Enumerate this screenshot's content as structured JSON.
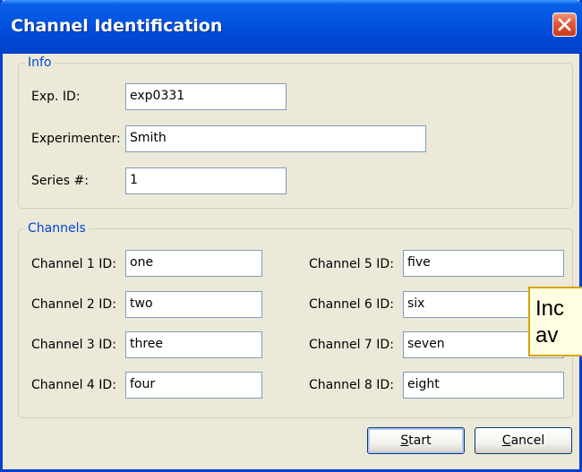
{
  "window": {
    "title": "Channel Identification"
  },
  "info": {
    "legend": "Info",
    "exp_id_label": "Exp. ID:",
    "exp_id_value": "exp0331",
    "experimenter_label": "Experimenter:",
    "experimenter_value": "Smith",
    "series_label": "Series #:",
    "series_value": "1"
  },
  "channels": {
    "legend": "Channels",
    "items": [
      {
        "label": "Channel 1 ID:",
        "value": "one"
      },
      {
        "label": "Channel 2 ID:",
        "value": "two"
      },
      {
        "label": "Channel 3 ID:",
        "value": "three"
      },
      {
        "label": "Channel 4 ID:",
        "value": "four"
      },
      {
        "label": "Channel 5 ID:",
        "value": "five"
      },
      {
        "label": "Channel 6 ID:",
        "value": "six"
      },
      {
        "label": "Channel 7 ID:",
        "value": "seven"
      },
      {
        "label": "Channel 8 ID:",
        "value": "eight"
      }
    ]
  },
  "buttons": {
    "start_mnemonic": "S",
    "start_rest": "tart",
    "cancel_mnemonic": "C",
    "cancel_rest": "ancel"
  },
  "tooltip": {
    "line1": "Inc",
    "line2": "av"
  },
  "icons": {
    "close": "close-icon"
  },
  "colors": {
    "title_bar": "#0047d4",
    "dialog_bg": "#ece9d8",
    "group_legend": "#0046d5",
    "close_button": "#e2583a",
    "tooltip_bg": "#ffffe1"
  }
}
